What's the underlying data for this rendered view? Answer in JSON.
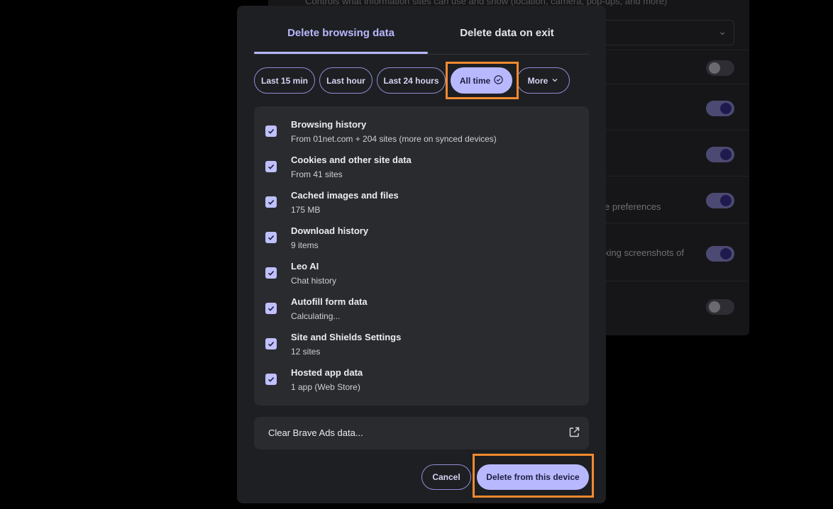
{
  "background": {
    "top_description": "Controls what information sites can use and show (location, camera, pop-ups, and more)",
    "row_text_preferences": "e preferences",
    "row_text_screenshots": "king screenshots of"
  },
  "dialog": {
    "tabs": [
      {
        "label": "Delete browsing data",
        "active": true
      },
      {
        "label": "Delete data on exit",
        "active": false
      }
    ],
    "time_ranges": [
      {
        "label": "Last 15 min"
      },
      {
        "label": "Last hour"
      },
      {
        "label": "Last 24 hours"
      },
      {
        "label": "All time",
        "selected": true
      },
      {
        "label": "More"
      }
    ],
    "items": [
      {
        "title": "Browsing history",
        "subtitle": "From 01net.com + 204 sites (more on synced devices)",
        "checked": true
      },
      {
        "title": "Cookies and other site data",
        "subtitle": "From 41 sites",
        "checked": true
      },
      {
        "title": "Cached images and files",
        "subtitle": "175 MB",
        "checked": true
      },
      {
        "title": "Download history",
        "subtitle": "9 items",
        "checked": true
      },
      {
        "title": "Leo AI",
        "subtitle": "Chat history",
        "checked": true
      },
      {
        "title": "Autofill form data",
        "subtitle": "Calculating...",
        "checked": true
      },
      {
        "title": "Site and Shields Settings",
        "subtitle": "12 sites",
        "checked": true
      },
      {
        "title": "Hosted app data",
        "subtitle": "1 app (Web Store)",
        "checked": true
      }
    ],
    "ads_label": "Clear Brave Ads data...",
    "cancel_label": "Cancel",
    "delete_label": "Delete from this device"
  },
  "colors": {
    "accent": "#b8b8ff",
    "highlight": "#f28a2e",
    "dialog_bg": "#1e1f22",
    "panel_bg": "#2a2b2f"
  }
}
